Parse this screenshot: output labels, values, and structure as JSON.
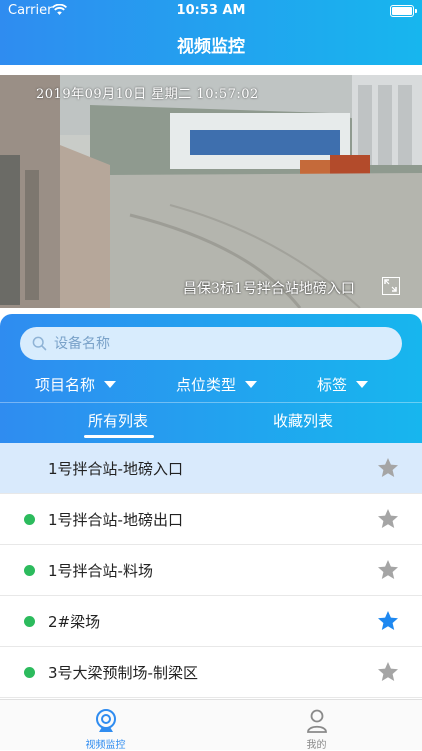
{
  "status_bar": {
    "carrier": "Carrier",
    "time": "10:53 AM"
  },
  "header": {
    "title": "视频监控"
  },
  "video": {
    "timestamp": "2019年09月10日  星期二  10:57:02",
    "camera_name": "昌保3标1号拌合站地磅入口"
  },
  "search": {
    "placeholder": "设备名称"
  },
  "filters": [
    {
      "label": "项目名称"
    },
    {
      "label": "点位类型"
    },
    {
      "label": "标签"
    }
  ],
  "tabs": [
    {
      "label": "所有列表",
      "active": true
    },
    {
      "label": "收藏列表",
      "active": false
    }
  ],
  "devices": [
    {
      "name": "1号拌合站-地磅入口",
      "online": false,
      "favorited": false,
      "selected": true
    },
    {
      "name": "1号拌合站-地磅出口",
      "online": true,
      "favorited": false,
      "selected": false
    },
    {
      "name": "1号拌合站-料场",
      "online": true,
      "favorited": false,
      "selected": false
    },
    {
      "name": "2#梁场",
      "online": true,
      "favorited": true,
      "selected": false
    },
    {
      "name": "3号大梁预制场-制梁区",
      "online": true,
      "favorited": false,
      "selected": false
    }
  ],
  "tabbar": [
    {
      "label": "视频监控",
      "active": true,
      "icon": "camera-icon"
    },
    {
      "label": "我的",
      "active": false,
      "icon": "user-icon"
    }
  ],
  "colors": {
    "accent": "#2f8cf0",
    "online": "#2cbb5d",
    "star_on": "#1e88f0",
    "star_off": "#a5a5a5",
    "selected_row": "#d9eafc"
  }
}
